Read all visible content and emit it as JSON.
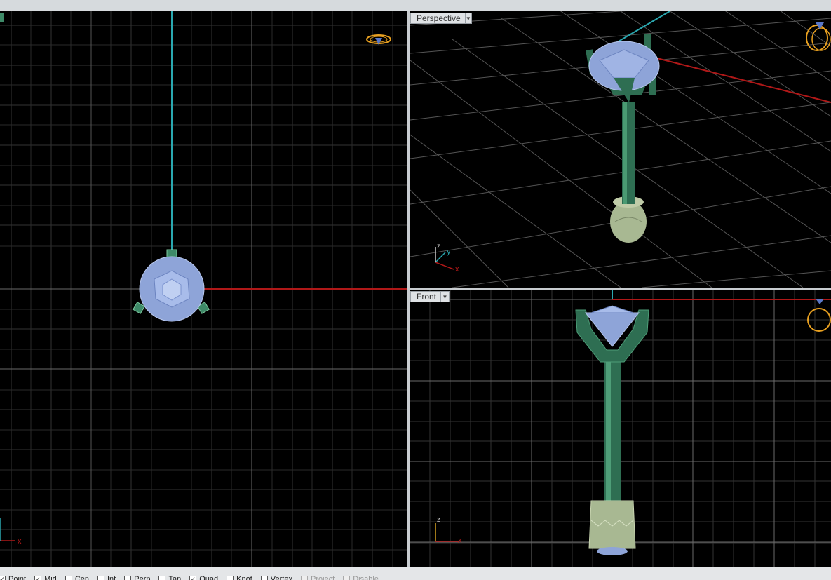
{
  "viewports": {
    "top": {
      "label": ""
    },
    "perspective": {
      "label": "Perspective"
    },
    "front": {
      "label": "Front"
    }
  },
  "axes": {
    "x": "x",
    "y": "y",
    "z": "z"
  },
  "colors": {
    "background": "#000000",
    "grid": "#3a3a3a",
    "grid_major": "#5a5a5a",
    "x_axis": "#b01818",
    "y_axis": "#2aa8b0",
    "gem": "#8ea4d8",
    "metal": "#2e6e52",
    "base": "#a8b892",
    "gumball": "#e8a020"
  },
  "osnaps": [
    {
      "label": "Point",
      "checked": true,
      "enabled": true
    },
    {
      "label": "Mid",
      "checked": true,
      "enabled": true
    },
    {
      "label": "Cen",
      "checked": false,
      "enabled": true
    },
    {
      "label": "Int",
      "checked": false,
      "enabled": true
    },
    {
      "label": "Perp",
      "checked": false,
      "enabled": true
    },
    {
      "label": "Tan",
      "checked": false,
      "enabled": true
    },
    {
      "label": "Quad",
      "checked": true,
      "enabled": true
    },
    {
      "label": "Knot",
      "checked": false,
      "enabled": true
    },
    {
      "label": "Vertex",
      "checked": false,
      "enabled": true
    },
    {
      "label": "Project",
      "checked": false,
      "enabled": false
    },
    {
      "label": "Disable",
      "checked": false,
      "enabled": false
    }
  ]
}
